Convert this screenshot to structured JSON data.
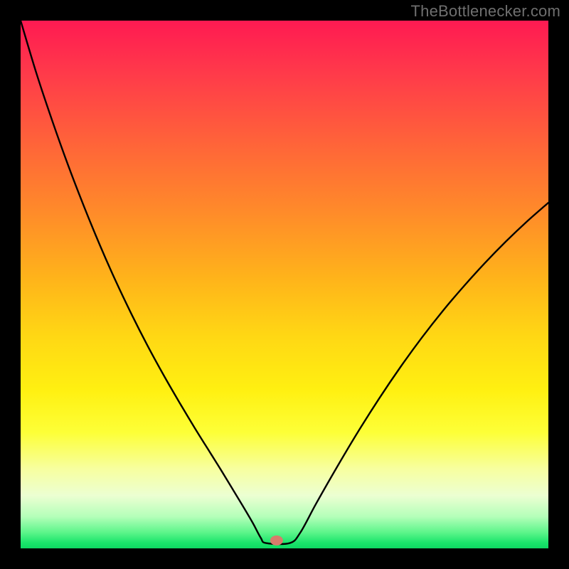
{
  "branding": {
    "text": "TheBottlenecker.com"
  },
  "marker": {
    "cx_frac": 0.485,
    "cy_frac": 0.985,
    "rx": 9,
    "ry": 7,
    "fill": "#d77b6b"
  },
  "chart_data": {
    "type": "line",
    "title": "",
    "xlabel": "",
    "ylabel": "",
    "xlim": [
      0,
      1
    ],
    "ylim": [
      0,
      1
    ],
    "series": [
      {
        "name": "curve",
        "x": [
          0.0,
          0.03,
          0.06,
          0.09,
          0.12,
          0.15,
          0.18,
          0.21,
          0.24,
          0.27,
          0.3,
          0.33,
          0.36,
          0.38,
          0.4,
          0.42,
          0.44,
          0.455,
          0.465,
          0.51,
          0.53,
          0.56,
          0.6,
          0.64,
          0.68,
          0.72,
          0.76,
          0.8,
          0.84,
          0.88,
          0.92,
          0.96,
          1.0
        ],
        "y": [
          1.0,
          0.9,
          0.81,
          0.726,
          0.648,
          0.575,
          0.507,
          0.444,
          0.385,
          0.33,
          0.278,
          0.228,
          0.18,
          0.148,
          0.115,
          0.082,
          0.048,
          0.02,
          0.01,
          0.01,
          0.03,
          0.085,
          0.155,
          0.222,
          0.285,
          0.344,
          0.399,
          0.45,
          0.497,
          0.541,
          0.582,
          0.62,
          0.655
        ]
      }
    ],
    "annotations": []
  }
}
